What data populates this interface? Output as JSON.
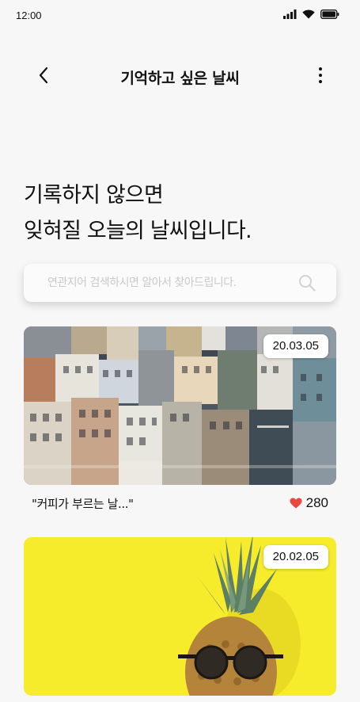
{
  "status_bar": {
    "time": "12:00",
    "icons": [
      "signal-icon",
      "wifi-icon",
      "battery-icon"
    ]
  },
  "app_bar": {
    "title": "기억하고 싶은 날씨",
    "back_icon": "chevron-left-icon",
    "more_icon": "more-vertical-icon"
  },
  "headline": {
    "line1": "기록하지 않으면",
    "line2": "잊혀질 오늘의 날씨입니다."
  },
  "search": {
    "placeholder": "연관지어 검색하시면 알아서 찾아드립니다.",
    "value": "",
    "icon": "search-icon"
  },
  "posts": [
    {
      "date": "20.03.05",
      "caption": "\"커피가 부르는 날...\"",
      "likes": "280",
      "like_icon": "heart-icon",
      "photo": "city-buildings-photo"
    },
    {
      "date": "20.02.05",
      "photo": "pineapple-sunglasses-photo"
    }
  ],
  "colors": {
    "background": "#f7f7f7",
    "heart": "#e8483f",
    "card2_background": "#f6ec2b"
  }
}
